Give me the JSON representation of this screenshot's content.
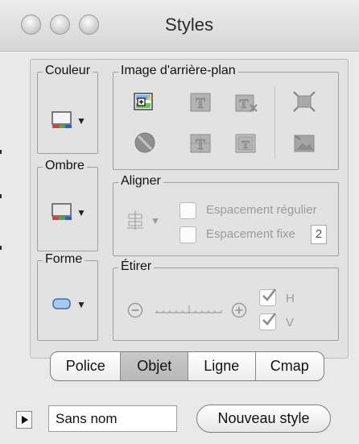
{
  "window": {
    "title": "Styles"
  },
  "groups": {
    "couleur": "Couleur",
    "ombre": "Ombre",
    "forme": "Forme",
    "image": "Image d'arrière-plan",
    "aligner": "Aligner",
    "etirer": "Étirer"
  },
  "aligner": {
    "regular_spacing_label": "Espacement régulier",
    "fixed_spacing_label": "Espacement fixe",
    "fixed_spacing_value": "2"
  },
  "etirer": {
    "h_label": "H",
    "v_label": "V",
    "h_checked": true,
    "v_checked": true
  },
  "tabs": [
    "Police",
    "Objet",
    "Ligne",
    "Cmap"
  ],
  "active_tab": "Objet",
  "footer": {
    "style_name_value": "Sans nom",
    "new_style_label": "Nouveau style"
  },
  "icons": {
    "image_row1": [
      "add-image-icon",
      "text-background-icon",
      "text-clear-icon",
      "fit-image-icon"
    ],
    "image_row2": [
      "no-image-icon",
      "text-tile-icon",
      "text-frame-icon",
      "image-stretch-icon"
    ]
  },
  "colors": {
    "window_bg": "#e9e9e9",
    "panel_bg": "#e2e2e2",
    "active_tab": "#c0c0c0",
    "disabled_text": "#9b9b9b"
  }
}
